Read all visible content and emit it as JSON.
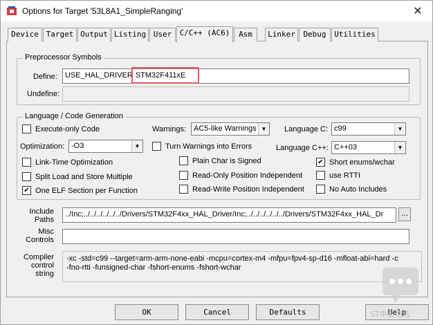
{
  "window": {
    "title": "Options for Target '53L8A1_SimpleRanging'",
    "close_glyph": "✕"
  },
  "tabs": [
    {
      "label": "Device"
    },
    {
      "label": "Target"
    },
    {
      "label": "Output"
    },
    {
      "label": "Listing"
    },
    {
      "label": "User"
    },
    {
      "label": "C/C++ (AC6)",
      "active": true
    },
    {
      "label": "Asm"
    },
    {
      "label": "Linker"
    },
    {
      "label": "Debug"
    },
    {
      "label": "Utilities"
    }
  ],
  "preprocessor": {
    "group_title": "Preprocessor Symbols",
    "define_label": "Define:",
    "define_prefix": "USE_HAL_DRIVER",
    "define_highlighted": "STM32F411xE",
    "undefine_label": "Undefine:",
    "undefine_value": ""
  },
  "language": {
    "group_title": "Language / Code Generation",
    "execute_only": {
      "label": "Execute-only Code",
      "checked": false
    },
    "warnings_label": "Warnings:",
    "warnings_value": "AC5-like Warnings",
    "language_c_label": "Language C:",
    "language_c_value": "c99",
    "optimization_label": "Optimization:",
    "optimization_value": "-O3",
    "turn_warnings_errors": {
      "label": "Turn Warnings into Errors",
      "checked": false
    },
    "language_cpp_label": "Language C++:",
    "language_cpp_value": "C++03",
    "link_time": {
      "label": "Link-Time Optimization",
      "checked": false
    },
    "plain_char": {
      "label": "Plain Char is Signed",
      "checked": false
    },
    "short_enums": {
      "label": "Short enums/wchar",
      "checked": true
    },
    "split_load": {
      "label": "Split Load and Store Multiple",
      "checked": false
    },
    "ropi": {
      "label": "Read-Only Position Independent",
      "checked": false
    },
    "use_rtti": {
      "label": "use RTTI",
      "checked": false
    },
    "one_elf": {
      "label": "One ELF Section per Function",
      "checked": true
    },
    "rwpi": {
      "label": "Read-Write Position Independent",
      "checked": false
    },
    "no_auto_includes": {
      "label": "No Auto Includes",
      "checked": false
    }
  },
  "include": {
    "label_line1": "Include",
    "label_line2": "Paths",
    "value": "../Inc;../../../../../../Drivers/STM32F4xx_HAL_Driver/Inc;../../../../../../Drivers/STM32F4xx_HAL_Dr",
    "browse_label": "..."
  },
  "misc": {
    "label_line1": "Misc",
    "label_line2": "Controls",
    "value": ""
  },
  "compiler": {
    "label_line1": "Compiler",
    "label_line2": "control",
    "label_line3": "string",
    "value": "-xc -std=c99 --target=arm-arm-none-eabi -mcpu=cortex-m4 -mfpu=fpv4-sp-d16 -mfloat-abi=hard -c\n-fno-rtti -funsigned-char -fshort-enums -fshort-wchar"
  },
  "buttons": {
    "ok": "OK",
    "cancel": "Cancel",
    "defaults": "Defaults",
    "help": "Help"
  },
  "watermark": {
    "text": "ST中文论坛",
    "icon": "chat-bubble-icon"
  },
  "colors": {
    "highlight_border": "#e05a6e",
    "background": "#f0f0f0"
  }
}
